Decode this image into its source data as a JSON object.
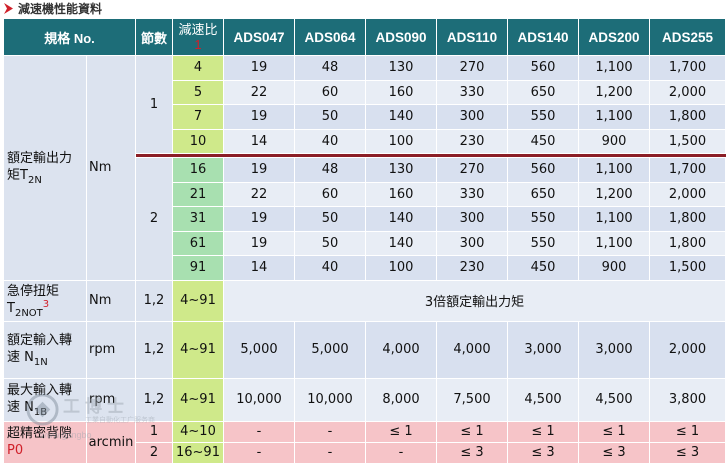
{
  "title": "減速機性能資料",
  "header": {
    "spec": "規格 No.",
    "stages": "節數",
    "ratio_line1": "減速比",
    "ratio_note": "1",
    "models": [
      "ADS047",
      "ADS064",
      "ADS090",
      "ADS110",
      "ADS140",
      "ADS200",
      "ADS255"
    ]
  },
  "torque": {
    "label_line1": "額定輸出力",
    "label_line2": "矩T",
    "label_sub": "2N",
    "unit": "Nm",
    "stage1": "1",
    "stage2": "2",
    "rows_stage1": [
      {
        "ratio": "4",
        "values": [
          "19",
          "48",
          "130",
          "270",
          "560",
          "1,100",
          "1,700"
        ]
      },
      {
        "ratio": "5",
        "values": [
          "22",
          "60",
          "160",
          "330",
          "650",
          "1,200",
          "2,000"
        ]
      },
      {
        "ratio": "7",
        "values": [
          "19",
          "50",
          "140",
          "300",
          "550",
          "1,100",
          "1,800"
        ]
      },
      {
        "ratio": "10",
        "values": [
          "14",
          "40",
          "100",
          "230",
          "450",
          "900",
          "1,500"
        ]
      }
    ],
    "rows_stage2": [
      {
        "ratio": "16",
        "values": [
          "19",
          "48",
          "130",
          "270",
          "560",
          "1,100",
          "1,700"
        ]
      },
      {
        "ratio": "21",
        "values": [
          "22",
          "60",
          "160",
          "330",
          "650",
          "1,200",
          "2,000"
        ]
      },
      {
        "ratio": "31",
        "values": [
          "19",
          "50",
          "140",
          "300",
          "550",
          "1,100",
          "1,800"
        ]
      },
      {
        "ratio": "61",
        "values": [
          "19",
          "50",
          "140",
          "300",
          "550",
          "1,100",
          "1,800"
        ]
      },
      {
        "ratio": "91",
        "values": [
          "14",
          "40",
          "100",
          "230",
          "450",
          "900",
          "1,500"
        ]
      }
    ]
  },
  "emergency": {
    "label_line1": "急停扭矩",
    "label_line2": "T",
    "label_sub": "2NOT",
    "label_note": "3",
    "unit": "Nm",
    "stages": "1,2",
    "ratio": "4~91",
    "value": "3倍額定輸出力矩"
  },
  "rated_speed": {
    "label_line1": "額定輸入轉",
    "label_line2": "速 N",
    "label_sub": "1N",
    "unit": "rpm",
    "stages": "1,2",
    "ratio": "4~91",
    "values": [
      "5,000",
      "5,000",
      "4,000",
      "4,000",
      "3,000",
      "3,000",
      "2,000"
    ]
  },
  "max_speed": {
    "label_line1": "最大輸入轉",
    "label_line2": "速 N",
    "label_sub": "1B",
    "unit": "rpm",
    "stages": "1,2",
    "ratio": "4~91",
    "values": [
      "10,000",
      "10,000",
      "8,000",
      "7,500",
      "4,500",
      "4,500",
      "3,800"
    ]
  },
  "backlash": {
    "label_line1": "超精密背隙",
    "label_line2": "P0",
    "unit": "arcmin",
    "rows": [
      {
        "stage": "1",
        "ratio": "4~10",
        "values": [
          "-",
          "-",
          "≤ 1",
          "≤ 1",
          "≤ 1",
          "≤ 1",
          "≤ 1"
        ]
      },
      {
        "stage": "2",
        "ratio": "16~91",
        "values": [
          "-",
          "-",
          "-",
          "≤ 3",
          "≤ 3",
          "≤ 3",
          "≤ 3"
        ]
      }
    ]
  },
  "watermark": {
    "name": "工博士",
    "subtitle": "工業自動化工广服务商",
    "url": "www.gongbo"
  }
}
